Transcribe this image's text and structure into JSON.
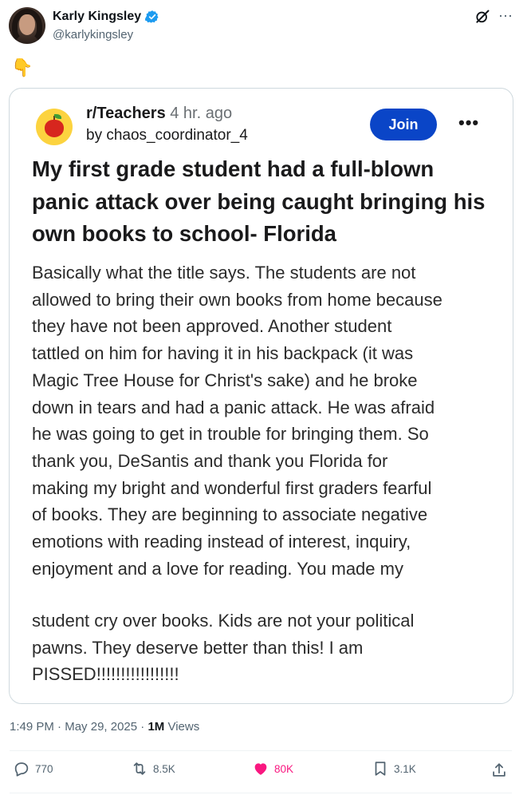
{
  "author": {
    "display_name": "Karly Kingsley",
    "handle": "@karlykingsley"
  },
  "tweet_text_emoji": "👇",
  "embedded_post": {
    "subreddit": "r/Teachers",
    "time_ago": "4 hr. ago",
    "by_line": "by chaos_coordinator_4",
    "join_label": "Join",
    "more_label": "•••",
    "title": "My first grade student had a full-blown panic attack over being caught bringing his own books to school- Florida",
    "body_part1": "Basically what the title says. The students are not\nallowed to bring their own books from home because\nthey have not been approved. Another student\ntattled on him for having it in his backpack (it was\nMagic Tree House for Christ's sake) and he broke\ndown in tears and had a panic attack. He was afraid\nhe was going to get in trouble for bringing them. So\nthank you, DeSantis and thank you Florida for\nmaking my bright and wonderful first graders fearful\nof books. They are beginning to associate negative\nemotions with reading instead of interest, inquiry,\nenjoyment and a love for reading. You made my",
    "body_part2": "student cry over books. Kids are not your political\npawns. They deserve better than this! I am\nPISSED!!!!!!!!!!!!!!!!!"
  },
  "meta": {
    "time": "1:49 PM",
    "separator": "·",
    "date": "May 29, 2025",
    "views_count": "1M",
    "views_label": "Views"
  },
  "actions": {
    "replies": "770",
    "reposts": "8.5K",
    "likes": "80K",
    "bookmarks": "3.1K"
  },
  "icons": [
    "verified-badge-icon",
    "grok-icon",
    "more-icon",
    "apple-icon",
    "reply-icon",
    "repost-icon",
    "like-icon",
    "bookmark-icon",
    "share-icon"
  ],
  "colors": {
    "verified": "#1d9bf0",
    "join_button": "#0a45c7",
    "like_active": "#f91880",
    "secondary_text": "#536471"
  }
}
